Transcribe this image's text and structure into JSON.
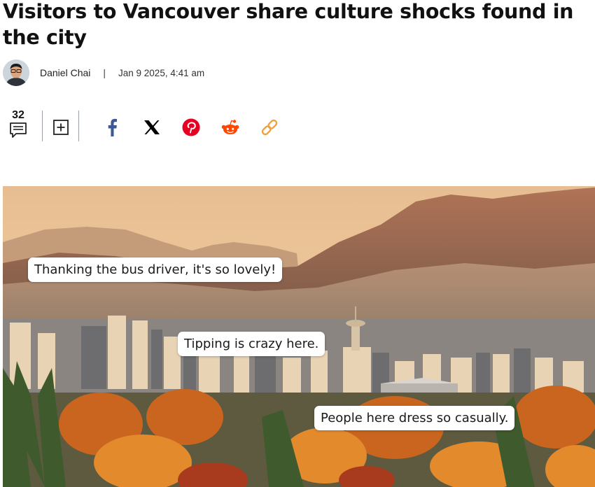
{
  "article": {
    "title": "Visitors to Vancouver share culture shocks found in the city",
    "author": "Daniel Chai",
    "separator": "|",
    "date": "Jan 9 2025, 4:41 am"
  },
  "actions": {
    "comment_count": "32",
    "icons": [
      "comment-icon",
      "save-icon",
      "facebook-icon",
      "x-icon",
      "pinterest-icon",
      "reddit-icon",
      "link-icon"
    ]
  },
  "image": {
    "quotes": [
      "Thanking the bus driver, it's so lovely!",
      "Tipping is crazy here.",
      "People here dress so casually."
    ]
  },
  "colors": {
    "facebook": "#3b5998",
    "x": "#000000",
    "pinterest": "#e60023",
    "reddit": "#ff4500",
    "link": "#f0a040"
  }
}
